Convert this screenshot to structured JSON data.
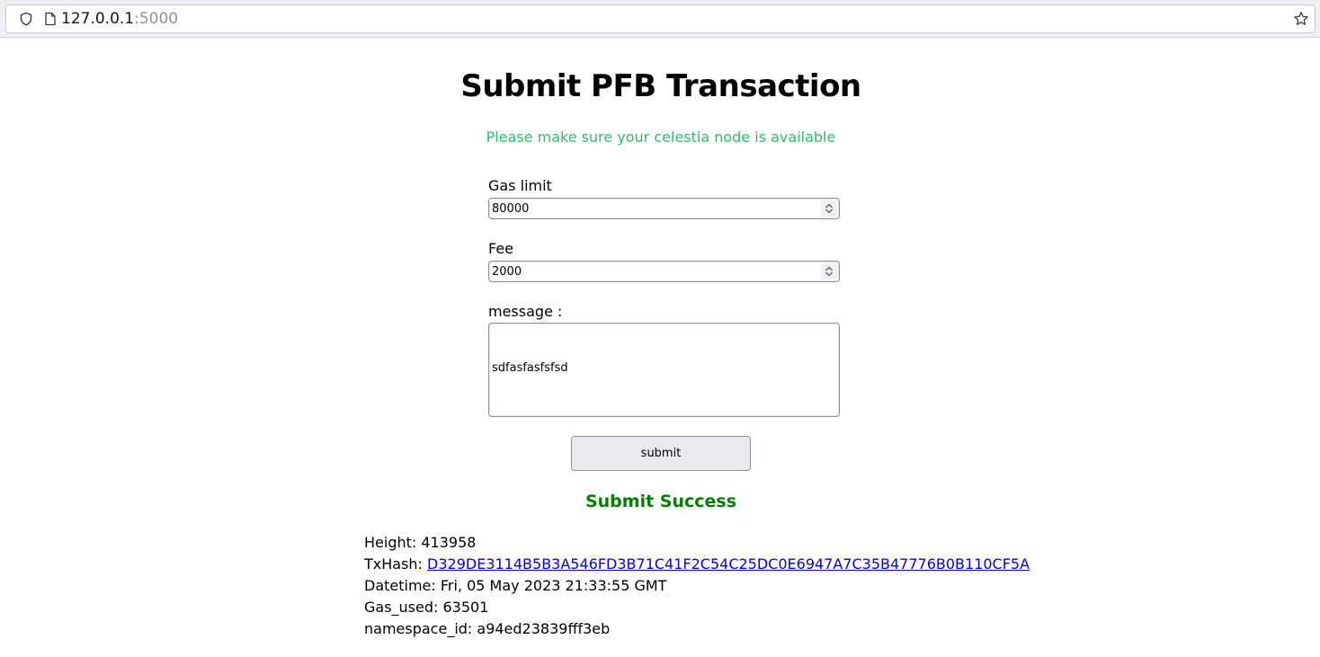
{
  "browser": {
    "url_host": "127.0.0.1",
    "url_port": ":5000"
  },
  "page": {
    "title": "Submit PFB Transaction",
    "notice": "Please make sure your celestia node is available",
    "notice_color": "#2ebd6b"
  },
  "form": {
    "gas_limit_label": "Gas limit",
    "gas_limit_value": "80000",
    "fee_label": "Fee",
    "fee_value": "2000",
    "message_label": "message :",
    "message_value": "sdfasfasfsfsd",
    "submit_label": "submit"
  },
  "result": {
    "status": "Submit Success",
    "status_color": "#008000",
    "height_label": "Height: ",
    "height_value": "413958",
    "txhash_label": "TxHash: ",
    "txhash_value": "D329DE3114B5B3A546FD3B71C41F2C54C25DC0E6947A7C35B47776B0B110CF5A",
    "datetime_label": "Datetime: ",
    "datetime_value": "Fri, 05 May 2023 21:33:55 GMT",
    "gas_used_label": "Gas_used: ",
    "gas_used_value": "63501",
    "namespace_label": "namespace_id: ",
    "namespace_value": "a94ed23839fff3eb"
  },
  "icons": {
    "shield": "shield-icon",
    "page": "page-icon",
    "star": "star-icon",
    "spinner_up": "chevron-up-icon",
    "spinner_down": "chevron-down-icon"
  }
}
